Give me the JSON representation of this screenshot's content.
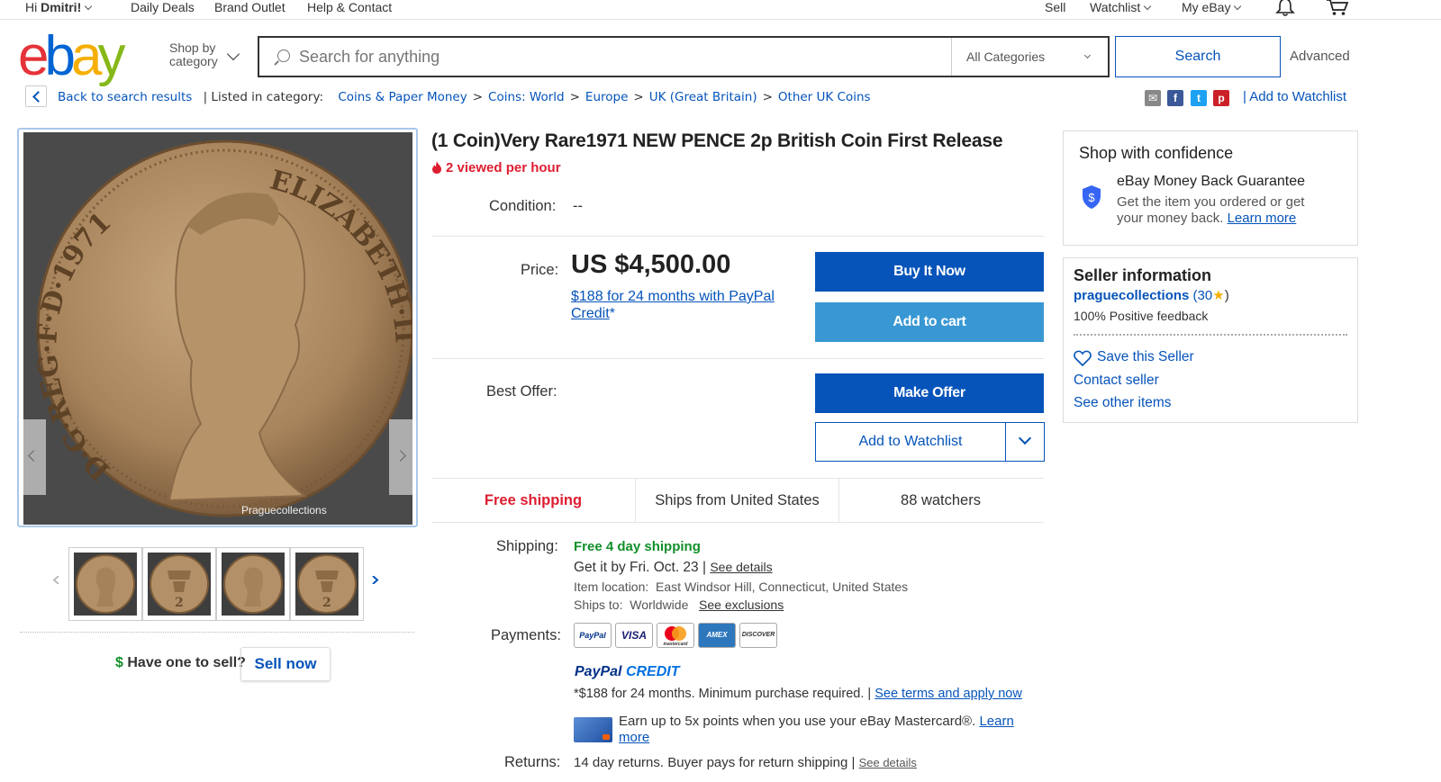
{
  "topbar": {
    "greeting_prefix": "Hi ",
    "user_name": "Dmitri!",
    "daily_deals": "Daily Deals",
    "brand_outlet": "Brand Outlet",
    "help_contact": "Help & Contact",
    "sell": "Sell",
    "watchlist": "Watchlist",
    "my_ebay": "My eBay",
    "icons": [
      "bell-icon",
      "cart-icon"
    ]
  },
  "header": {
    "logo": {
      "e": "e",
      "b": "b",
      "a": "a",
      "y": "y"
    },
    "shop_by_line1": "Shop by",
    "shop_by_line2": "category",
    "search_placeholder": "Search for anything",
    "category_selected": "All Categories",
    "search_button": "Search",
    "advanced": "Advanced"
  },
  "breadcrumb": {
    "back": "Back to search results",
    "listed_in": "| Listed in category:",
    "items": [
      "Coins & Paper Money",
      "Coins: World",
      "Europe",
      "UK (Great Britain)",
      "Other UK Coins"
    ],
    "share_icons": [
      "email-icon",
      "facebook-icon",
      "twitter-icon",
      "pinterest-icon"
    ],
    "add_to_watchlist": "| Add to Watchlist"
  },
  "gallery": {
    "watermark": "Praguecollections",
    "coin_legend_left": "D·G·REG·F·D·1971",
    "coin_legend_right": "ELIZABETH·II",
    "thumbnails": [
      "thumbnail-obverse-1",
      "thumbnail-reverse-1",
      "thumbnail-obverse-2",
      "thumbnail-reverse-2"
    ],
    "have_one": "Have one to sell?",
    "sell_now": "Sell now"
  },
  "listing": {
    "title": "(1 Coin)Very Rare1971 NEW PENCE 2p British Coin First Release",
    "viewed": "2 viewed per hour",
    "condition_label": "Condition:",
    "condition_value": "--",
    "price_label": "Price:",
    "price": "US $4,500.00",
    "credit_offer": "$188 for 24 months with PayPal Credit",
    "credit_asterisk": "*",
    "buy_now": "Buy It Now",
    "add_to_cart": "Add to cart",
    "best_offer_label": "Best Offer:",
    "make_offer": "Make Offer",
    "add_to_watchlist": "Add to Watchlist",
    "free_shipping": "Free shipping",
    "ships_from": "Ships from United States",
    "watchers": "88 watchers",
    "shipping_label": "Shipping:",
    "shipping_value": "Free 4 day shipping",
    "get_it_by": "Get it by Fri. Oct. 23 |",
    "see_details": "See details",
    "item_location_label": "Item location:",
    "item_location": "East Windsor Hill, Connecticut, United States",
    "ships_to_label": "Ships to:",
    "ships_to": "Worldwide",
    "see_exclusions": "See exclusions",
    "payments_label": "Payments:",
    "payment_cards": [
      "PayPal",
      "VISA",
      "mastercard",
      "AMEX",
      "DISCOVER"
    ],
    "paypal_credit_1": "PayPal",
    "paypal_credit_2": "CREDIT",
    "credit_terms": "*$188 for 24 months. Minimum purchase required.  |",
    "see_terms": "See terms and apply now",
    "earn_points": "Earn up to 5x points when you use your eBay Mastercard®.",
    "learn_more": "Learn more",
    "returns_label": "Returns:",
    "returns_value": "14 day returns. Buyer pays for return shipping |",
    "returns_details": "See details"
  },
  "sidebar": {
    "confidence_title": "Shop with confidence",
    "guarantee_title": "eBay Money Back Guarantee",
    "guarantee_text_1": "Get the item you ordered or get",
    "guarantee_text_2": "your money back.",
    "learn_more": "Learn more",
    "seller_title": "Seller information",
    "seller_name": "praguecollections",
    "seller_score_open": "(30",
    "seller_score_close": ")",
    "feedback": "100% Positive feedback",
    "save_seller": "Save this Seller",
    "contact_seller": "Contact seller",
    "see_other": "See other items"
  },
  "colors": {
    "ebay_blue": "#0654ba",
    "cart_blue": "#3998d3",
    "alert_red": "#dd1e31",
    "success_green": "#128f2a",
    "star": "#f5af02"
  }
}
